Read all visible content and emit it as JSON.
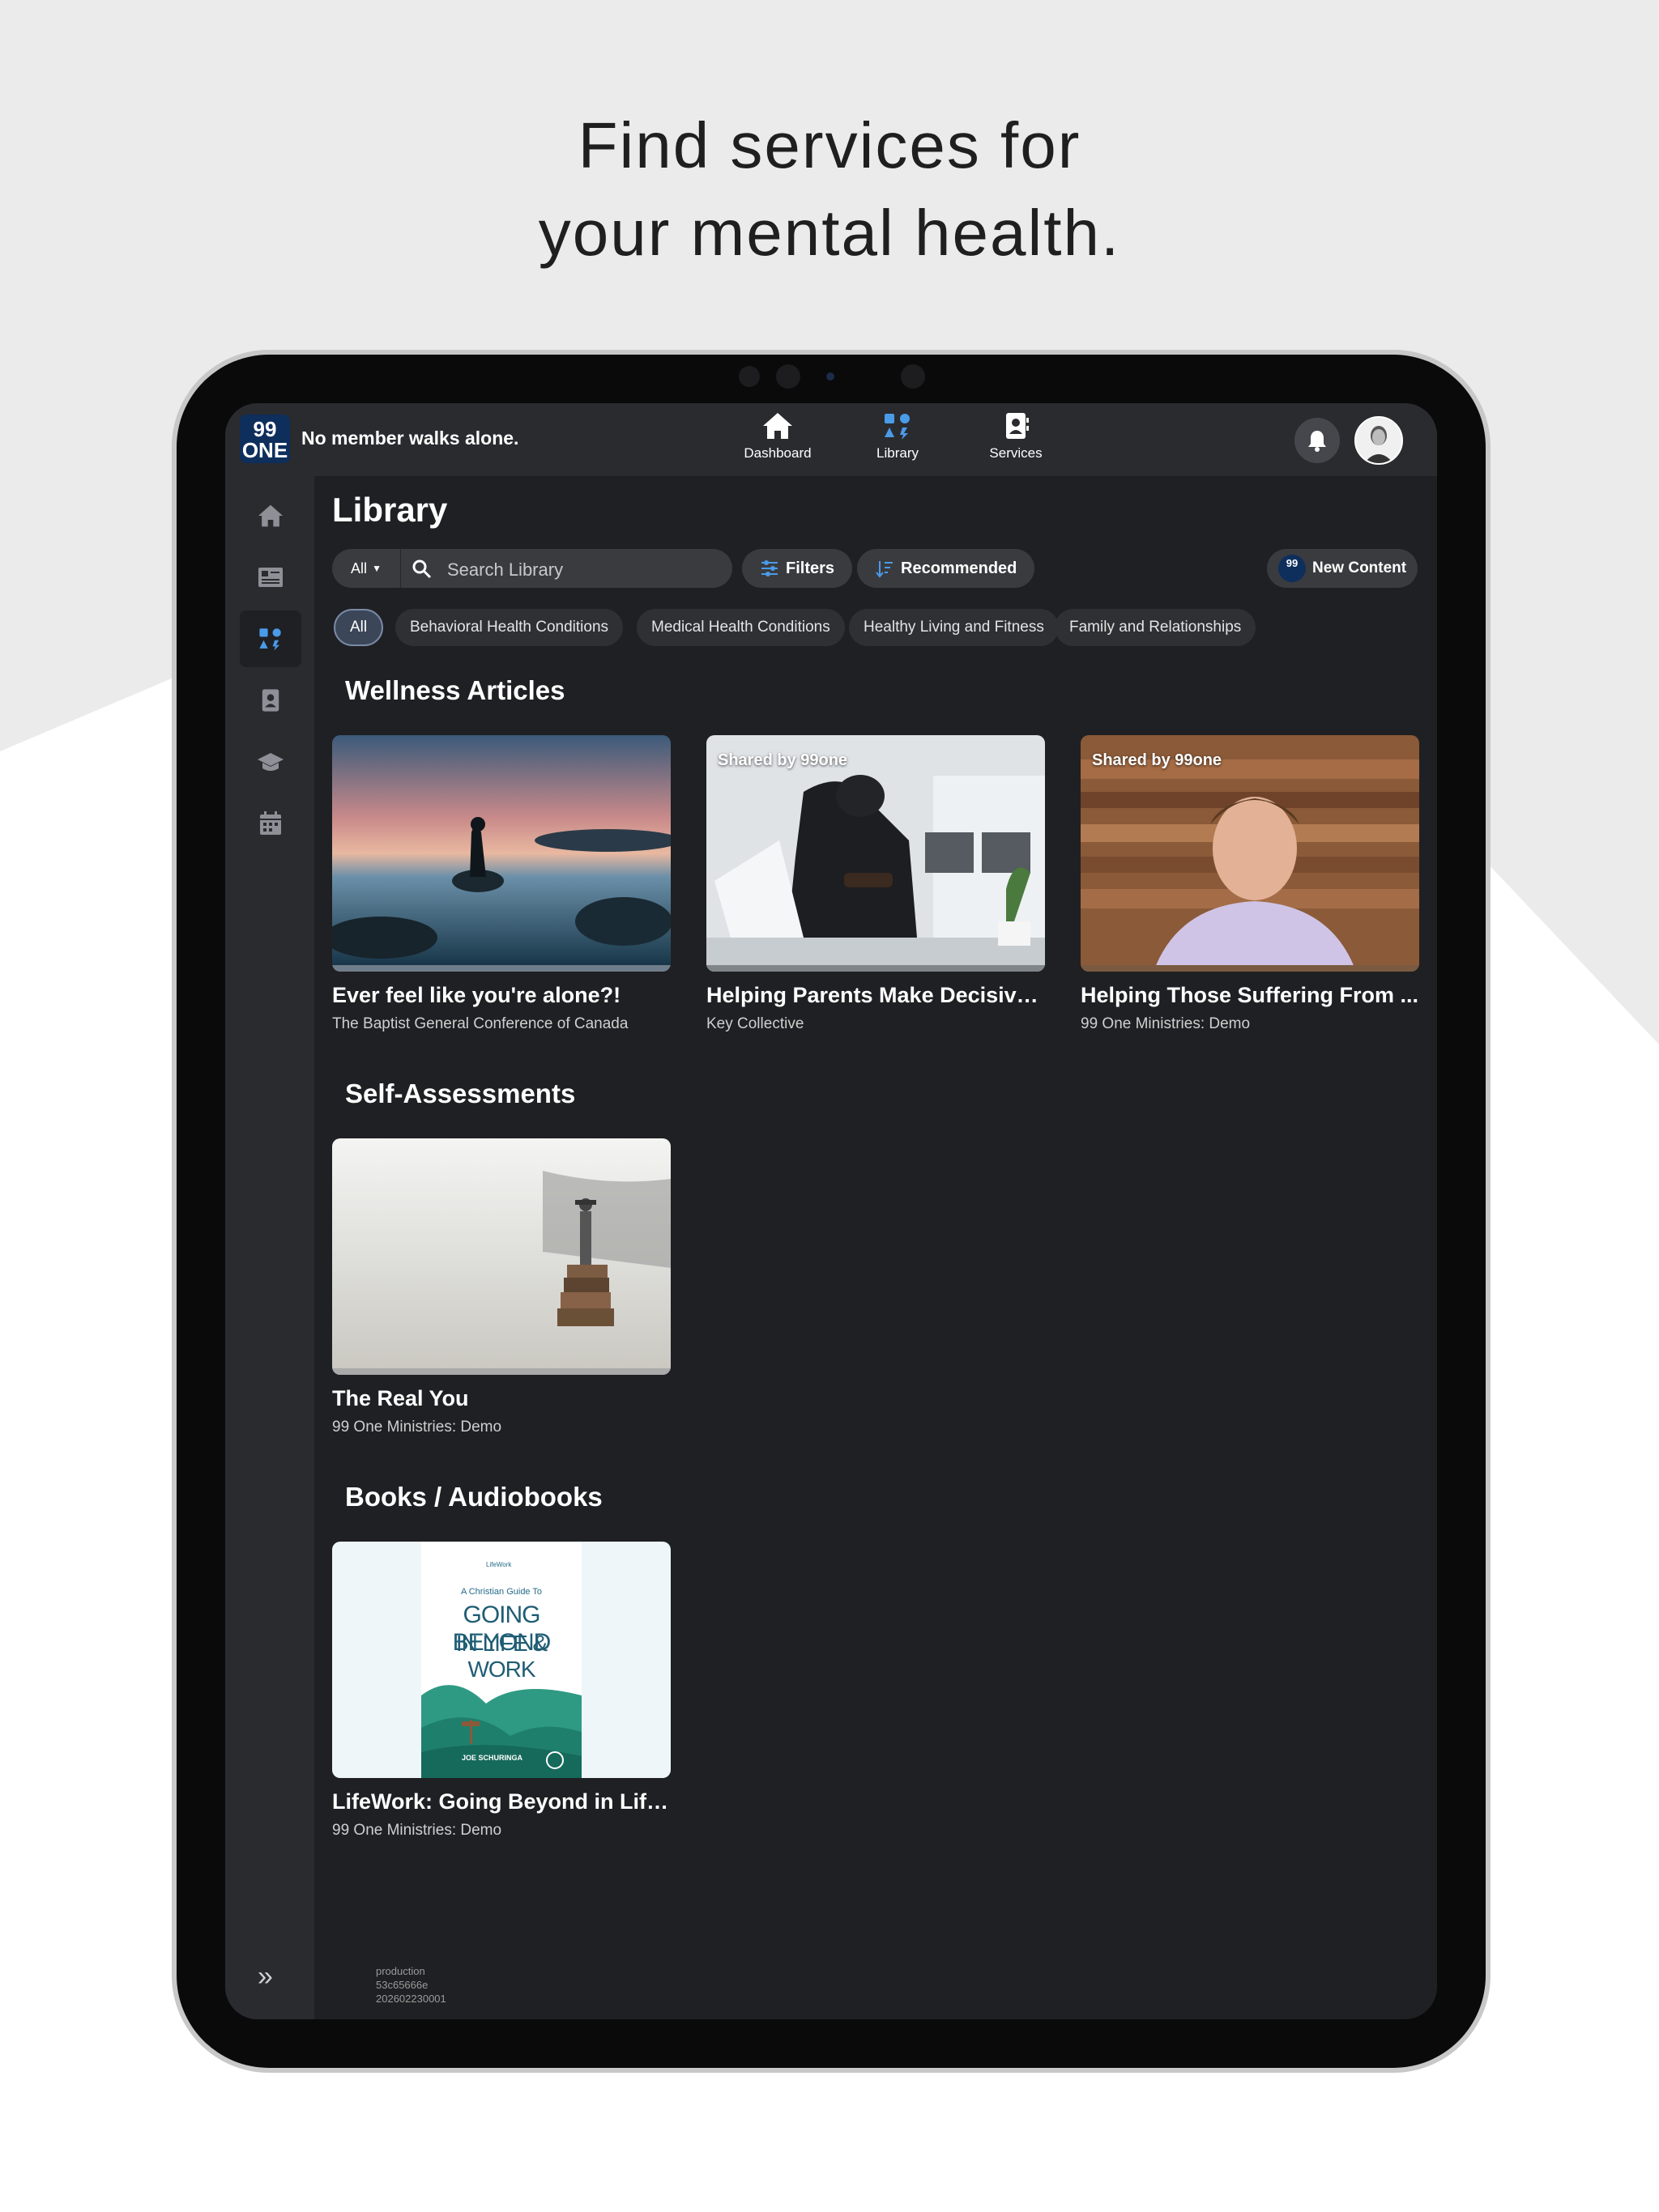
{
  "headline": {
    "line1": "Find services for",
    "line2": "your mental health."
  },
  "app": {
    "logo": {
      "top": "99",
      "bottom": "ONE"
    },
    "tagline": "No member walks alone.",
    "nav": [
      {
        "label": "Dashboard",
        "icon": "home-icon"
      },
      {
        "label": "Library",
        "icon": "library-icon"
      },
      {
        "label": "Services",
        "icon": "contact-book-icon"
      }
    ],
    "sidebar_icons": [
      "home-icon",
      "news-icon",
      "library-icon",
      "contact-book-icon",
      "graduation-cap-icon",
      "calendar-icon"
    ],
    "accent": "#4a9be8"
  },
  "library": {
    "title": "Library",
    "search": {
      "scope": "All",
      "placeholder": "Search Library"
    },
    "filters_label": "Filters",
    "sort_label": "Recommended",
    "new_content_label": "New Content",
    "categories": [
      "All",
      "Behavioral Health Conditions",
      "Medical Health Conditions",
      "Healthy Living and Fitness",
      "Family and Relationships"
    ]
  },
  "sections": [
    {
      "title": "Wellness Articles",
      "cards": [
        {
          "title": "Ever feel like you're alone?!",
          "source": "The Baptist General Conference of Canada",
          "badge": ""
        },
        {
          "title": "Helping Parents Make Decisive ...",
          "source": "Key Collective",
          "badge": "Shared by 99one"
        },
        {
          "title": "Helping Those Suffering From ...",
          "source": "99 One Ministries: Demo",
          "badge": "Shared by 99one"
        }
      ]
    },
    {
      "title": "Self-Assessments",
      "cards": [
        {
          "title": "The Real You",
          "source": "99 One Ministries: Demo"
        }
      ]
    },
    {
      "title": "Books / Audiobooks",
      "cards": [
        {
          "title": "LifeWork: Going Beyond in Life ...",
          "source": "99 One Ministries: Demo",
          "cover": {
            "brand": "LifeWork",
            "kicker": "A Christian Guide To",
            "line1": "GOING BEYOND",
            "line2": "IN LIFE & WORK",
            "author": "JOE SCHURINGA"
          }
        }
      ]
    }
  ],
  "build_info": [
    "production",
    "53c65666e",
    "202602230001"
  ]
}
